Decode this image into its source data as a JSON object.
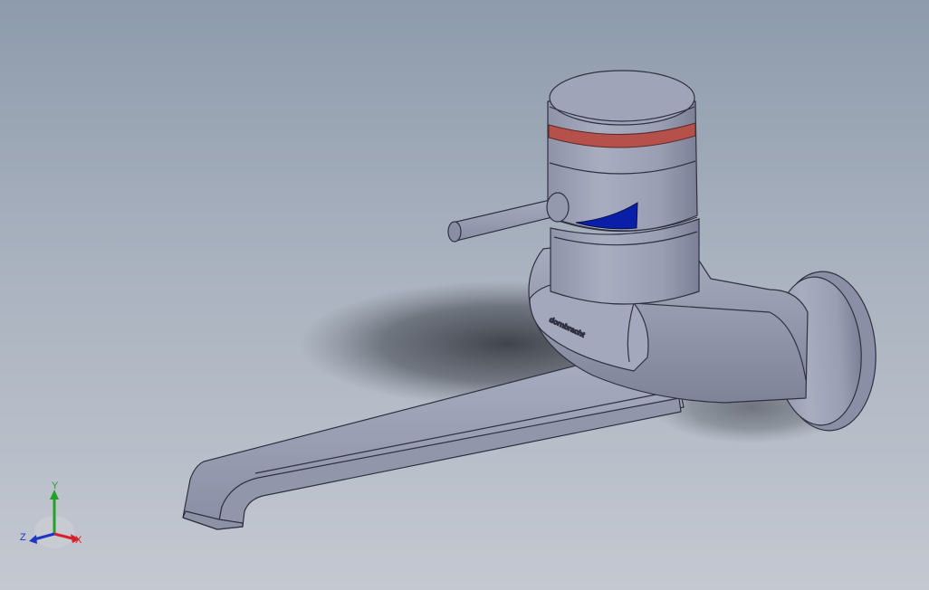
{
  "model": {
    "brand_text": "dornbracht",
    "colors": {
      "metal": "#9a9eb3",
      "metal_dark": "#5f6277",
      "indicator_red": "#b5504a",
      "indicator_blue": "#0a1fa8"
    }
  },
  "triad": {
    "x_label": "X",
    "y_label": "Y",
    "z_label": "Z",
    "x_color": "#d8202a",
    "y_color": "#22a22a",
    "z_color": "#1d36c7"
  }
}
